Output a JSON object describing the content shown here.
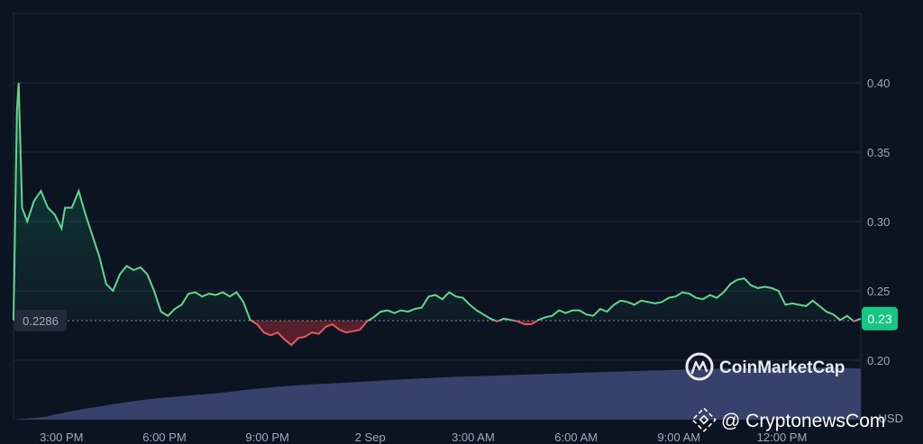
{
  "chart_data": {
    "type": "area",
    "baseline": 0.2286,
    "baseline_label": "0.2286",
    "current_value": 0.23,
    "current_label": "0.23",
    "ylim": [
      0.17,
      0.4
    ],
    "y_ticks": [
      {
        "value": 0.4,
        "label": "0.40"
      },
      {
        "value": 0.35,
        "label": "0.35"
      },
      {
        "value": 0.3,
        "label": "0.30"
      },
      {
        "value": 0.25,
        "label": "0.25"
      },
      {
        "value": 0.2,
        "label": "0.20"
      }
    ],
    "x_ticks": [
      {
        "t": 1.5,
        "label": "3:00 PM"
      },
      {
        "t": 4.5,
        "label": "6:00 PM"
      },
      {
        "t": 7.5,
        "label": "9:00 PM"
      },
      {
        "t": 10.5,
        "label": "2 Sep"
      },
      {
        "t": 13.5,
        "label": "3:00 AM"
      },
      {
        "t": 16.5,
        "label": "6:00 AM"
      },
      {
        "t": 19.5,
        "label": "9:00 AM"
      },
      {
        "t": 22.5,
        "label": "12:00 PM"
      }
    ],
    "x_range": [
      0.1,
      24.8
    ],
    "y_unit_label": "USD",
    "price": {
      "name": "Price",
      "points": [
        [
          0.1,
          0.229
        ],
        [
          0.2,
          0.38
        ],
        [
          0.25,
          0.4
        ],
        [
          0.35,
          0.31
        ],
        [
          0.5,
          0.3
        ],
        [
          0.7,
          0.315
        ],
        [
          0.9,
          0.322
        ],
        [
          1.1,
          0.31
        ],
        [
          1.3,
          0.305
        ],
        [
          1.5,
          0.295
        ],
        [
          1.6,
          0.31
        ],
        [
          1.8,
          0.31
        ],
        [
          2.0,
          0.322
        ],
        [
          2.2,
          0.305
        ],
        [
          2.4,
          0.29
        ],
        [
          2.6,
          0.275
        ],
        [
          2.8,
          0.255
        ],
        [
          3.0,
          0.25
        ],
        [
          3.2,
          0.262
        ],
        [
          3.4,
          0.268
        ],
        [
          3.6,
          0.265
        ],
        [
          3.8,
          0.267
        ],
        [
          4.0,
          0.262
        ],
        [
          4.2,
          0.25
        ],
        [
          4.4,
          0.235
        ],
        [
          4.6,
          0.232
        ],
        [
          4.8,
          0.237
        ],
        [
          5.0,
          0.24
        ],
        [
          5.2,
          0.248
        ],
        [
          5.4,
          0.249
        ],
        [
          5.6,
          0.246
        ],
        [
          5.8,
          0.248
        ],
        [
          6.0,
          0.247
        ],
        [
          6.2,
          0.249
        ],
        [
          6.4,
          0.246
        ],
        [
          6.6,
          0.249
        ],
        [
          6.8,
          0.242
        ],
        [
          7.0,
          0.229
        ],
        [
          7.2,
          0.226
        ],
        [
          7.4,
          0.22
        ],
        [
          7.6,
          0.218
        ],
        [
          7.8,
          0.22
        ],
        [
          8.0,
          0.215
        ],
        [
          8.2,
          0.211
        ],
        [
          8.4,
          0.216
        ],
        [
          8.6,
          0.217
        ],
        [
          8.8,
          0.22
        ],
        [
          9.0,
          0.219
        ],
        [
          9.2,
          0.224
        ],
        [
          9.4,
          0.226
        ],
        [
          9.6,
          0.222
        ],
        [
          9.8,
          0.22
        ],
        [
          10.0,
          0.221
        ],
        [
          10.2,
          0.222
        ],
        [
          10.4,
          0.228
        ],
        [
          10.6,
          0.231
        ],
        [
          10.8,
          0.235
        ],
        [
          11.0,
          0.236
        ],
        [
          11.2,
          0.234
        ],
        [
          11.4,
          0.236
        ],
        [
          11.6,
          0.235
        ],
        [
          11.8,
          0.237
        ],
        [
          12.0,
          0.238
        ],
        [
          12.2,
          0.246
        ],
        [
          12.4,
          0.247
        ],
        [
          12.6,
          0.244
        ],
        [
          12.8,
          0.249
        ],
        [
          13.0,
          0.246
        ],
        [
          13.2,
          0.245
        ],
        [
          13.4,
          0.24
        ],
        [
          13.6,
          0.236
        ],
        [
          13.8,
          0.233
        ],
        [
          14.0,
          0.23
        ],
        [
          14.2,
          0.228
        ],
        [
          14.4,
          0.23
        ],
        [
          14.6,
          0.229
        ],
        [
          14.8,
          0.228
        ],
        [
          15.0,
          0.226
        ],
        [
          15.2,
          0.226
        ],
        [
          15.4,
          0.229
        ],
        [
          15.6,
          0.231
        ],
        [
          15.8,
          0.232
        ],
        [
          16.0,
          0.236
        ],
        [
          16.2,
          0.234
        ],
        [
          16.4,
          0.236
        ],
        [
          16.6,
          0.236
        ],
        [
          16.8,
          0.233
        ],
        [
          17.0,
          0.232
        ],
        [
          17.2,
          0.237
        ],
        [
          17.4,
          0.235
        ],
        [
          17.6,
          0.24
        ],
        [
          17.8,
          0.243
        ],
        [
          18.0,
          0.242
        ],
        [
          18.2,
          0.24
        ],
        [
          18.4,
          0.243
        ],
        [
          18.6,
          0.242
        ],
        [
          18.8,
          0.241
        ],
        [
          19.0,
          0.242
        ],
        [
          19.2,
          0.245
        ],
        [
          19.4,
          0.246
        ],
        [
          19.6,
          0.249
        ],
        [
          19.8,
          0.248
        ],
        [
          20.0,
          0.245
        ],
        [
          20.2,
          0.244
        ],
        [
          20.4,
          0.247
        ],
        [
          20.6,
          0.245
        ],
        [
          20.8,
          0.249
        ],
        [
          21.0,
          0.255
        ],
        [
          21.2,
          0.258
        ],
        [
          21.4,
          0.259
        ],
        [
          21.6,
          0.254
        ],
        [
          21.8,
          0.252
        ],
        [
          22.0,
          0.253
        ],
        [
          22.2,
          0.252
        ],
        [
          22.4,
          0.25
        ],
        [
          22.6,
          0.24
        ],
        [
          22.8,
          0.241
        ],
        [
          23.0,
          0.24
        ],
        [
          23.2,
          0.239
        ],
        [
          23.4,
          0.243
        ],
        [
          23.6,
          0.239
        ],
        [
          23.8,
          0.235
        ],
        [
          24.0,
          0.233
        ],
        [
          24.2,
          0.229
        ],
        [
          24.4,
          0.232
        ],
        [
          24.6,
          0.228
        ],
        [
          24.8,
          0.23
        ]
      ]
    },
    "volume": {
      "name": "Volume",
      "relative_points": [
        [
          0.1,
          0.0
        ],
        [
          0.5,
          0.02
        ],
        [
          1.0,
          0.05
        ],
        [
          1.5,
          0.12
        ],
        [
          2.0,
          0.18
        ],
        [
          3.0,
          0.28
        ],
        [
          4.0,
          0.37
        ],
        [
          5.0,
          0.43
        ],
        [
          6.0,
          0.48
        ],
        [
          7.0,
          0.55
        ],
        [
          8.0,
          0.61
        ],
        [
          9.0,
          0.65
        ],
        [
          10.0,
          0.68
        ],
        [
          11.0,
          0.72
        ],
        [
          12.0,
          0.75
        ],
        [
          13.0,
          0.78
        ],
        [
          14.0,
          0.8
        ],
        [
          15.0,
          0.82
        ],
        [
          16.0,
          0.84
        ],
        [
          17.0,
          0.86
        ],
        [
          18.0,
          0.88
        ],
        [
          19.0,
          0.9
        ],
        [
          20.0,
          0.92
        ],
        [
          21.0,
          0.93
        ],
        [
          22.0,
          0.94
        ],
        [
          23.0,
          0.95
        ],
        [
          24.0,
          0.95
        ],
        [
          24.8,
          0.93
        ]
      ]
    },
    "colors": {
      "up": "#16c784",
      "up_line": "#62d58f",
      "down": "#ea3943",
      "down_line": "#e05a5a",
      "volume": "#3e4a78",
      "badge": "#16c784",
      "background": "#0d1421",
      "grid": "#232a3a"
    }
  },
  "watermark": {
    "text": "CoinMarketCap",
    "icon": "coinmarketcap-logo-icon"
  },
  "source": {
    "text": "@ CryptonewsCom",
    "icon": "binance-logo-icon"
  }
}
